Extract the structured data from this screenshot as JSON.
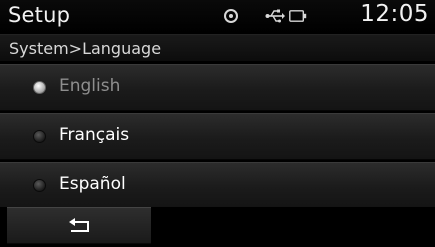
{
  "header": {
    "title": "Setup",
    "clock": "12:05",
    "icons": [
      "disc-icon",
      "usb-icon",
      "battery-icon"
    ]
  },
  "breadcrumb": {
    "text": "System>Language"
  },
  "options": [
    {
      "label": "English",
      "state": "disabled"
    },
    {
      "label": "Français",
      "state": "enabled"
    },
    {
      "label": "Español",
      "state": "enabled"
    }
  ],
  "footer": {
    "back_icon": "return-arrow-icon"
  }
}
